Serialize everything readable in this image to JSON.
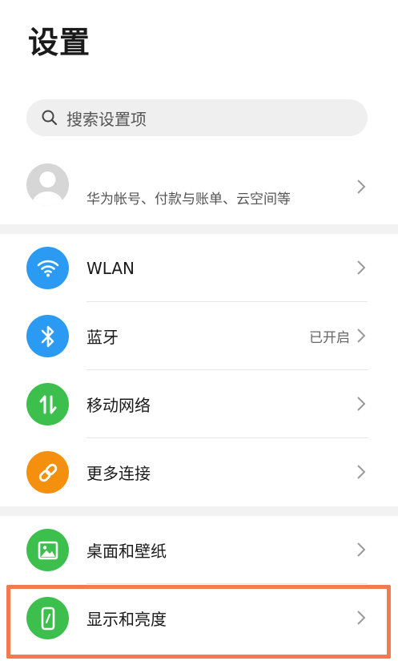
{
  "page": {
    "title": "设置"
  },
  "search": {
    "placeholder": "搜索设置项"
  },
  "account": {
    "subtitle": "华为帐号、付款与账单、云空间等"
  },
  "items": [
    {
      "key": "wlan",
      "label": "WLAN",
      "status": "",
      "icon": "wifi-icon",
      "color": "#2b9af3"
    },
    {
      "key": "bluetooth",
      "label": "蓝牙",
      "status": "已开启",
      "icon": "bluetooth-icon",
      "color": "#2b9af3"
    },
    {
      "key": "mobile-network",
      "label": "移动网络",
      "status": "",
      "icon": "mobile-data-icon",
      "color": "#3cbf4c"
    },
    {
      "key": "more-connections",
      "label": "更多连接",
      "status": "",
      "icon": "link-icon",
      "color": "#f5900f"
    },
    {
      "key": "desktop-wallpaper",
      "label": "桌面和壁纸",
      "status": "",
      "icon": "picture-icon",
      "color": "#3cbf4c"
    },
    {
      "key": "display-brightness",
      "label": "显示和亮度",
      "status": "",
      "icon": "phone-brightness-icon",
      "color": "#3cbf4c"
    }
  ],
  "colors": {
    "highlight": "#f47a4f",
    "search_bg": "#efefef"
  }
}
